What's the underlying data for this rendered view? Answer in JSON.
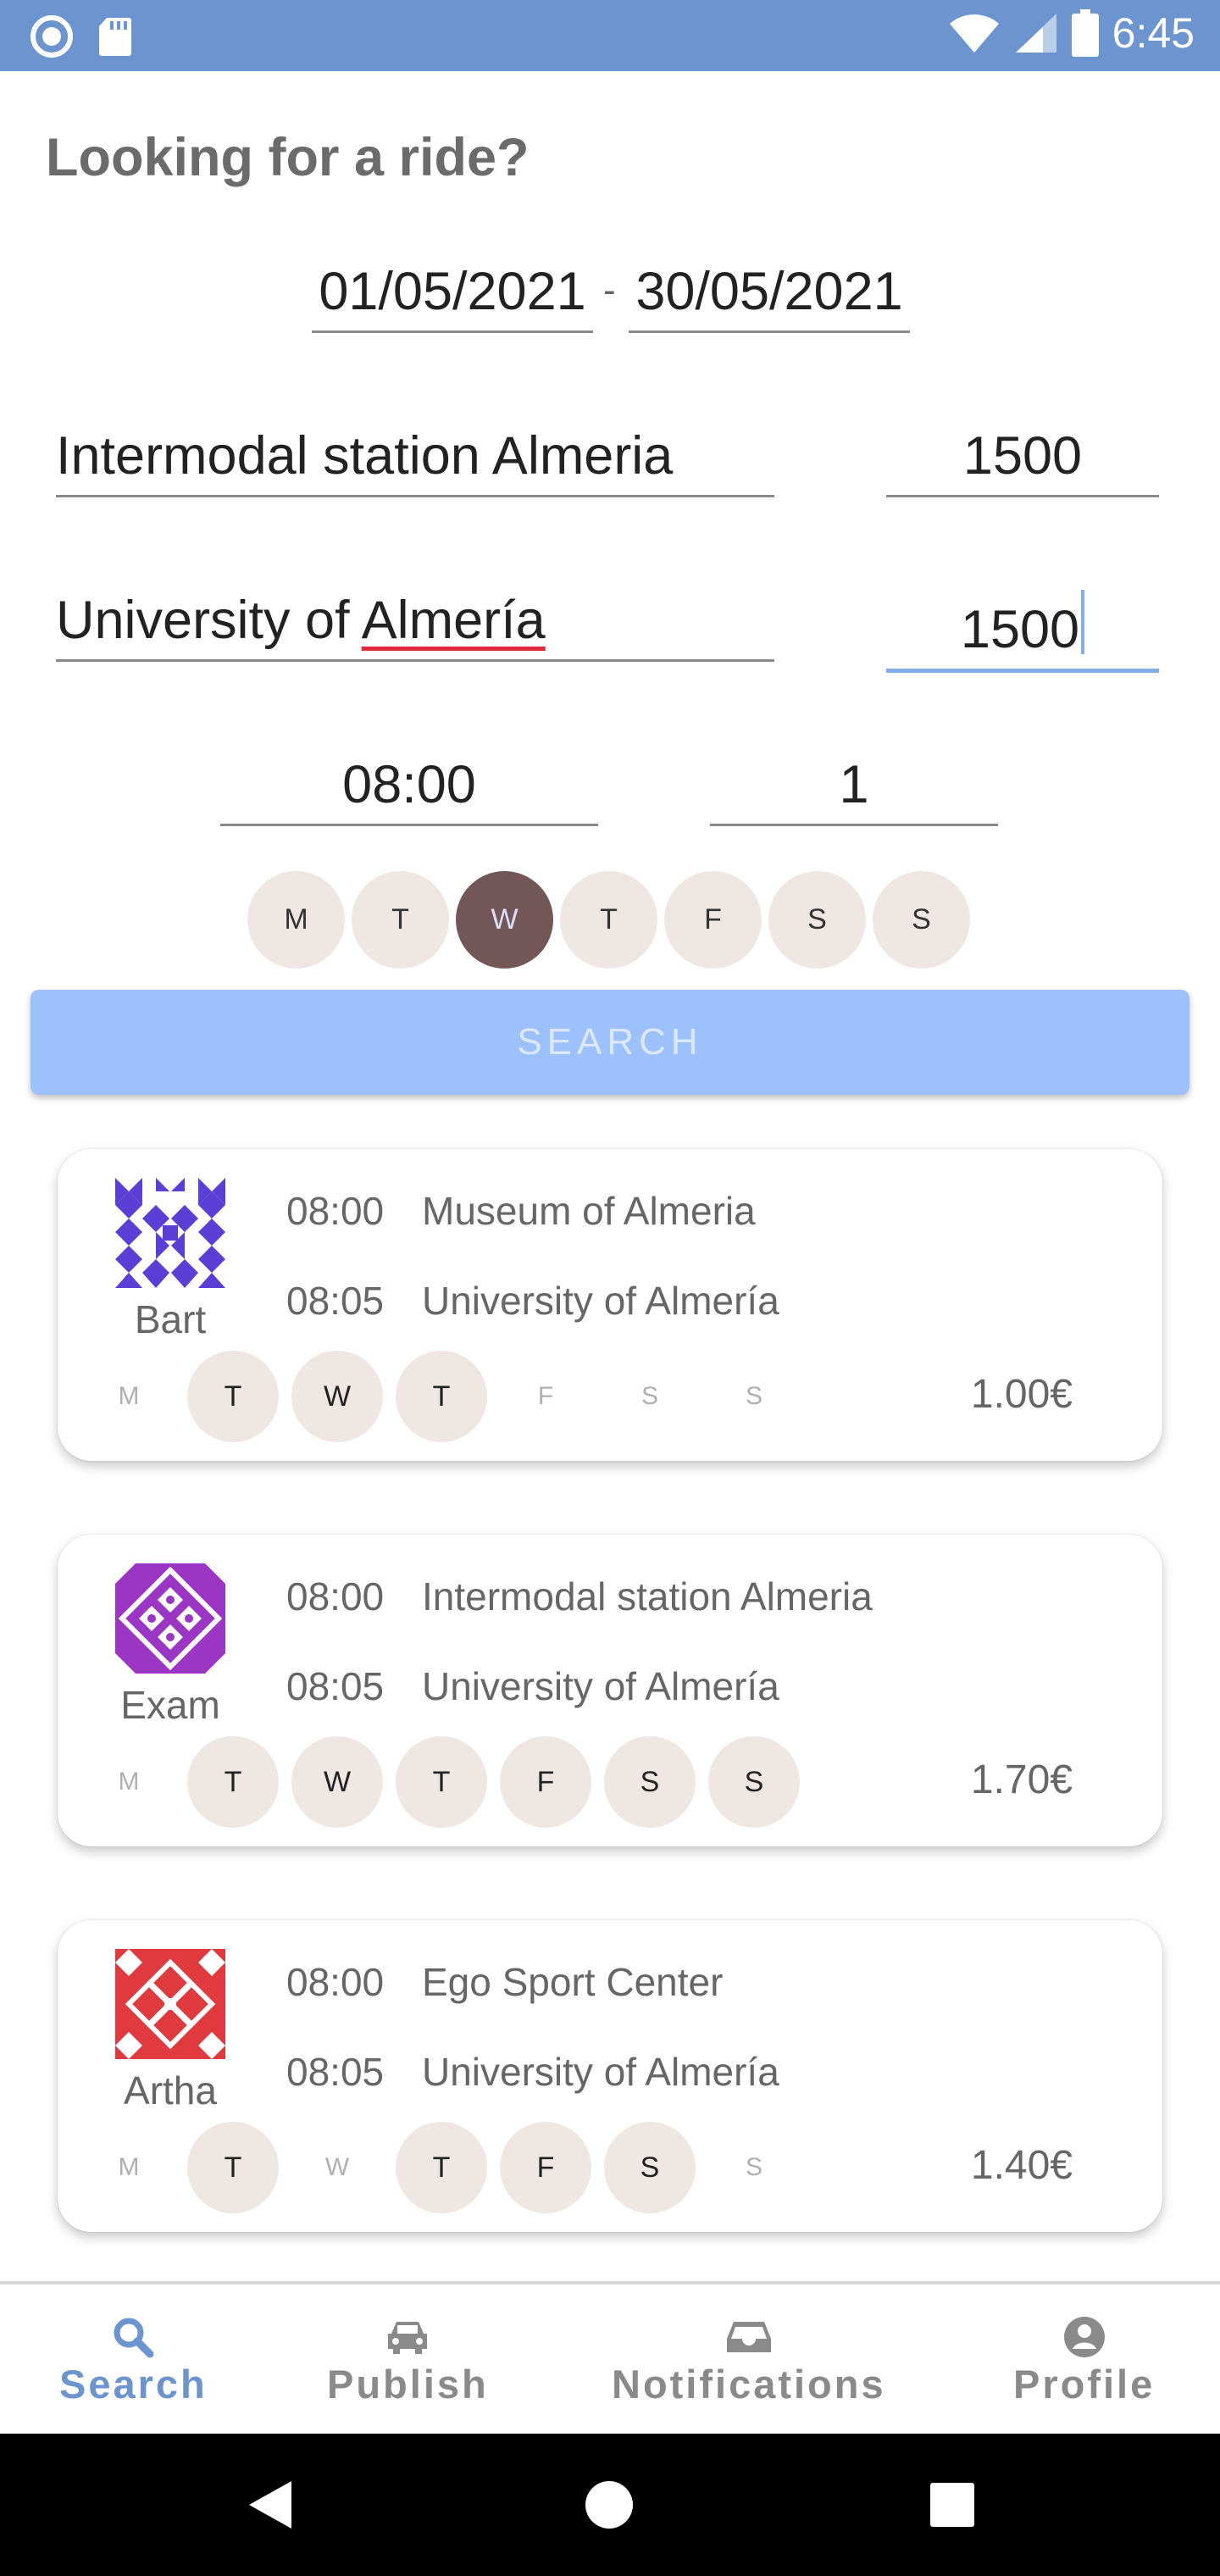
{
  "status_bar": {
    "time": "6:45"
  },
  "title": "Looking for a ride?",
  "search_form": {
    "date_from": "01/05/2021",
    "date_separator": "-",
    "date_to": "30/05/2021",
    "origin": "Intermodal station Almeria",
    "origin_radius": "1500",
    "destination_part1": "University of ",
    "destination_part2": "Almería",
    "destination_radius": "1500",
    "time": "08:00",
    "seats": "1",
    "days": [
      {
        "label": "M",
        "selected": false
      },
      {
        "label": "T",
        "selected": false
      },
      {
        "label": "W",
        "selected": true
      },
      {
        "label": "T",
        "selected": false
      },
      {
        "label": "F",
        "selected": false
      },
      {
        "label": "S",
        "selected": false
      },
      {
        "label": "S",
        "selected": false
      }
    ],
    "search_label": "SEARCH"
  },
  "results": [
    {
      "driver": "Bart",
      "avatar_color": "#5a3fd6",
      "depart_time": "08:00",
      "depart_place": "Museum of Almeria",
      "arrive_time": "08:05",
      "arrive_place": "University of Almería",
      "days": [
        "M",
        "T",
        "W",
        "T",
        "F",
        "S",
        "S"
      ],
      "active": [
        false,
        true,
        true,
        true,
        false,
        false,
        false
      ],
      "price": "1.00€"
    },
    {
      "driver": "Exam",
      "avatar_color": "#9a35c4",
      "depart_time": "08:00",
      "depart_place": "Intermodal station Almeria",
      "arrive_time": "08:05",
      "arrive_place": "University of Almería",
      "days": [
        "M",
        "T",
        "W",
        "T",
        "F",
        "S",
        "S"
      ],
      "active": [
        false,
        true,
        true,
        true,
        true,
        true,
        true
      ],
      "price": "1.70€"
    },
    {
      "driver": "Artha",
      "avatar_color": "#e0393e",
      "depart_time": "08:00",
      "depart_place": "Ego Sport Center",
      "arrive_time": "08:05",
      "arrive_place": "University of Almería",
      "days": [
        "M",
        "T",
        "W",
        "T",
        "F",
        "S",
        "S"
      ],
      "active": [
        false,
        true,
        false,
        true,
        true,
        true,
        false
      ],
      "price": "1.40€"
    }
  ],
  "nav": [
    {
      "label": "Search",
      "icon": "search-icon",
      "active": true
    },
    {
      "label": "Publish",
      "icon": "car-icon",
      "active": false
    },
    {
      "label": "Notifications",
      "icon": "inbox-icon",
      "active": false
    },
    {
      "label": "Profile",
      "icon": "account-icon",
      "active": false
    }
  ],
  "colors": {
    "accent": "#6c94cf",
    "search_button": "#9dc1fc",
    "day_selected": "#735658",
    "day_chip": "#efe7e3"
  }
}
